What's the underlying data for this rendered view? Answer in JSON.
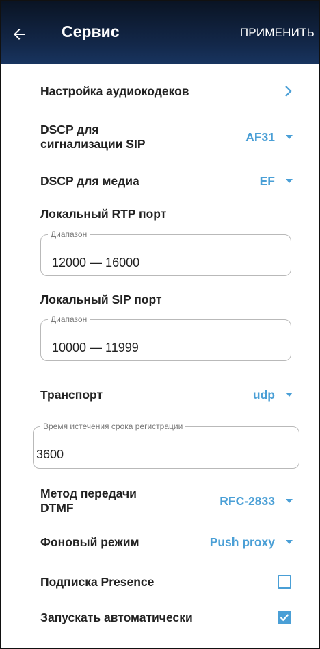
{
  "header": {
    "title": "Сервис",
    "apply_label": "ПРИМЕНИТЬ"
  },
  "audio_codecs": {
    "label": "Настройка аудиокодеков"
  },
  "dscp_sip": {
    "label_line1": "DSCP для",
    "label_line2": "сигнализации SIP",
    "value": "AF31"
  },
  "dscp_media": {
    "label": "DSCP для медиа",
    "value": "EF"
  },
  "rtp_port": {
    "label": "Локальный RTP порт",
    "field_legend": "Диапазон",
    "value": "12000 — 16000"
  },
  "sip_port": {
    "label": "Локальный SIP порт",
    "field_legend": "Диапазон",
    "value": "10000 — 11999"
  },
  "transport": {
    "label": "Транспорт",
    "value": "udp"
  },
  "registration": {
    "field_legend": "Время истечения срока регистрации",
    "value": "3600"
  },
  "dtmf": {
    "label_line1": "Метод передачи",
    "label_line2": "DTMF",
    "value": "RFC-2833"
  },
  "background_mode": {
    "label": "Фоновый режим",
    "value": "Push proxy"
  },
  "presence": {
    "label": "Подписка Presence",
    "checked": false
  },
  "autostart": {
    "label": "Запускать автоматически",
    "checked": true
  },
  "colors": {
    "accent": "#4a9fd6",
    "appbar": "#13284a"
  }
}
